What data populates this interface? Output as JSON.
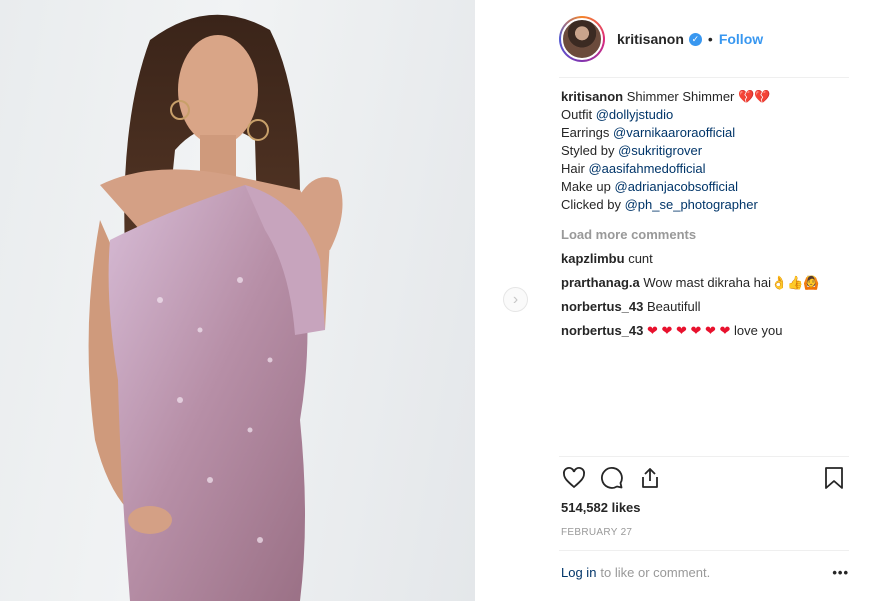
{
  "post": {
    "username": "kritisanon",
    "follow_label": "Follow",
    "separator": "•",
    "verified_icon": "verified-badge-icon"
  },
  "caption": {
    "username": "kritisanon",
    "text": "Shimmer Shimmer",
    "emojis": "💔💔",
    "lines": [
      {
        "prefix": "Outfit",
        "mention": "@dollyjstudio"
      },
      {
        "prefix": "Earrings",
        "mention": "@varnikaaroraofficial"
      },
      {
        "prefix": "Styled by",
        "mention": "@sukritigrover"
      },
      {
        "prefix": "Hair",
        "mention": "@aasifahmedofficial"
      },
      {
        "prefix": "Make up",
        "mention": "@adrianjacobsofficial"
      },
      {
        "prefix": "Clicked by",
        "mention": "@ph_se_photographer"
      }
    ]
  },
  "load_more_label": "Load more comments",
  "comments": [
    {
      "user": "kapzlimbu",
      "text": "cunt"
    },
    {
      "user": "prarthanag.a",
      "text": "Wow mast dikraha hai👌👍🙆"
    },
    {
      "user": "norbertus_43",
      "text": "Beautifull"
    },
    {
      "user": "norbertus_43",
      "hearts": "❤ ❤ ❤ ❤ ❤ ❤",
      "text": "love you"
    }
  ],
  "actions": {
    "like_icon": "heart-icon",
    "comment_icon": "comment-icon",
    "share_icon": "share-icon",
    "save_icon": "bookmark-icon"
  },
  "likes_text": "514,582 likes",
  "date_text": "FEBRUARY 27",
  "login": {
    "link_label": "Log in",
    "rest_text": "to like or comment.",
    "more_label": "•••"
  },
  "nav": {
    "next_label": "›"
  },
  "colors": {
    "accent": "#3897f0",
    "mention": "#003569",
    "muted": "#999999",
    "heart": "#e8112d"
  }
}
